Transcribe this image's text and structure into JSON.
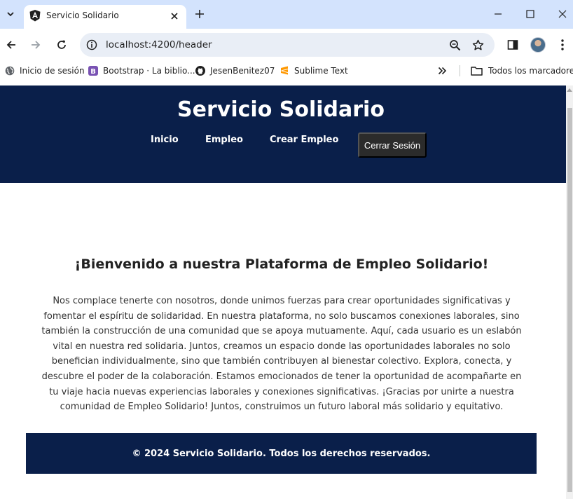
{
  "browser": {
    "tab": {
      "title": "Servicio Solidario",
      "favicon": "angular-icon"
    },
    "url": "localhost:4200/header",
    "bookmarks": [
      {
        "label": "Inicio de sesión",
        "icon": "globe-icon"
      },
      {
        "label": "Bootstrap · La biblio...",
        "icon": "bootstrap-icon"
      },
      {
        "label": "JesenBenitez07",
        "icon": "github-icon"
      },
      {
        "label": "Sublime Text",
        "icon": "sublime-icon"
      }
    ],
    "all_bookmarks_label": "Todos los marcadores"
  },
  "page": {
    "header": {
      "title": "Servicio Solidario",
      "nav": [
        "Inicio",
        "Empleo",
        "Crear Empleo"
      ],
      "logout_label": "Cerrar Sesión"
    },
    "welcome": {
      "title": "¡Bienvenido a nuestra Plataforma de Empleo Solidario!",
      "text": "Nos complace tenerte con nosotros, donde unimos fuerzas para crear oportunidades significativas y fomentar el espíritu de solidaridad. En nuestra plataforma, no solo buscamos conexiones laborales, sino también la construcción de una comunidad que se apoya mutuamente. Aquí, cada usuario es un eslabón vital en nuestra red solidaria. Juntos, creamos un espacio donde las oportunidades laborales no solo benefician individualmente, sino que también contribuyen al bienestar colectivo. Explora, conecta, y descubre el poder de la colaboración. Estamos emocionados de tener la oportunidad de acompañarte en tu viaje hacia nuevas experiencias laborales y conexiones significativas. ¡Gracias por unirte a nuestra comunidad de Empleo Solidario! Juntos, construimos un futuro laboral más solidario y equitativo."
    },
    "footer": {
      "text": "© 2024 Servicio Solidario. Todos los derechos reservados."
    }
  },
  "colors": {
    "header_bg": "#0a1f4a",
    "footer_bg": "#0a1f4a",
    "logout_bg": "#2b2b2b",
    "chrome_tabstrip": "#d3e3fd",
    "omnibox_bg": "#e9eef6"
  }
}
